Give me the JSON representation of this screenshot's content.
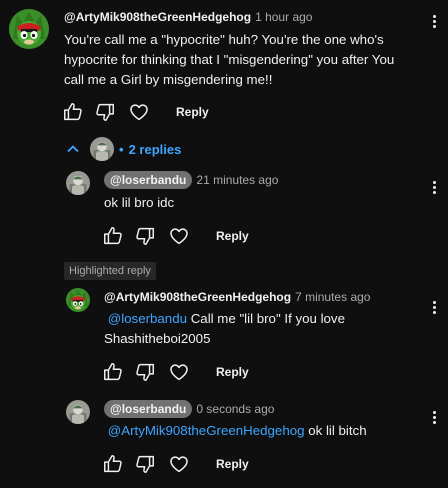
{
  "top_comment": {
    "author": "@ArtyMik908theGreenHedgehog",
    "time": "1 hour ago",
    "text_lines": [
      "You're call me a \"hypocrite\" huh? You're the one who's",
      "hypocrite for thinking that I \"misgendering\" you after You",
      "call me a Girl by misgendering me!!"
    ],
    "reply_label": "Reply"
  },
  "replies_toggle": {
    "label": "2 replies",
    "bullet": "•"
  },
  "replies": [
    {
      "author": "@loserbandu",
      "time": "21 minutes ago",
      "text": "ok lil bro idc",
      "reply_label": "Reply"
    },
    {
      "highlight_label": "Highlighted reply",
      "author": "@ArtyMik908theGreenHedgehog",
      "time": "7 minutes ago",
      "mention": "@loserbandu",
      "text_line1": " Call me \"lil bro\" If you love",
      "text_line2": "Shashitheboi2005",
      "reply_label": "Reply"
    },
    {
      "author": "@loserbandu",
      "time": "0 seconds ago",
      "mention": "@ArtyMik908theGreenHedgehog",
      "text": " ok lil bitch",
      "reply_label": "Reply"
    }
  ],
  "colors": {
    "background": "#0f0f0f",
    "text": "#f1f1f1",
    "secondary_text": "#aaaaaa",
    "link": "#3ea6ff",
    "chip": "#717171"
  },
  "icons": {
    "like": "thumbs-up-icon",
    "dislike": "thumbs-down-icon",
    "heart": "heart-icon",
    "more": "more-vert-icon",
    "chevron": "chevron-up-icon"
  }
}
